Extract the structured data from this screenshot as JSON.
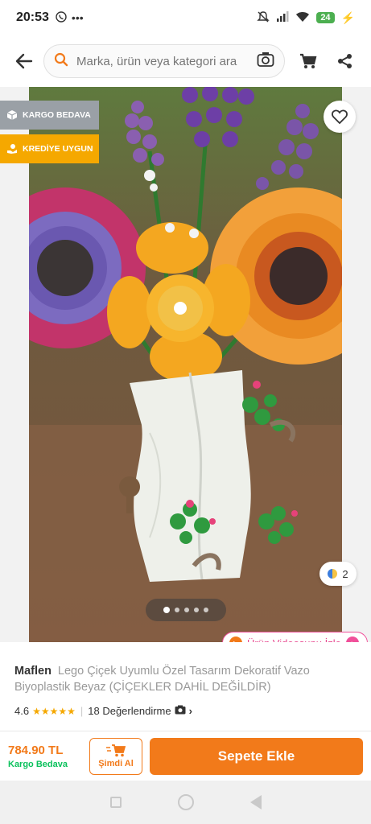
{
  "status_bar": {
    "time": "20:53",
    "left_icons": [
      "whatsapp-icon",
      "more-dots-icon"
    ],
    "battery": "24"
  },
  "header": {
    "search_placeholder": "Marka, ürün veya kategori ara"
  },
  "gallery": {
    "badges": {
      "kargo": "KARGO BEDAVA",
      "kredi": "KREDİYE UYGUN"
    },
    "image_count": "2",
    "video_button": "Ürün Videosunu İzle",
    "page_dots": 5,
    "active_dot": 0
  },
  "product": {
    "brand": "Maflen",
    "name": "Lego Çiçek Uyumlu Özel Tasarım Dekoratif Vazo Biyoplastik Beyaz (ÇİÇEKLER DAHİL DEĞİLDİR)",
    "rating": "4.6",
    "stars": "★★★★★",
    "reviews": "18 Değerlendirme"
  },
  "bottom_bar": {
    "price": "784.90 TL",
    "cargo": "Kargo Bedava",
    "buy_now": "Şimdi Al",
    "add_to_cart": "Sepete Ekle"
  },
  "colors": {
    "accent": "#f27a1a",
    "green": "#0bc15c"
  }
}
